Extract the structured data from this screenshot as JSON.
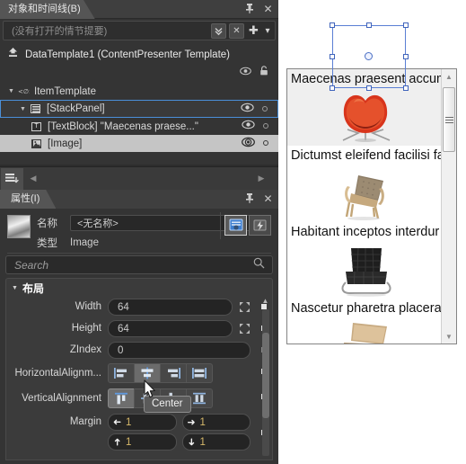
{
  "objects_panel": {
    "tab_label": "对象和时间线(B)",
    "pin_icon": "pin-icon",
    "close_icon": "close-icon",
    "storyboard_placeholder": "(没有打开的情节提要)",
    "storyboard_chevron_icon": "chevrons-down-icon",
    "storyboard_close_icon": "close-icon",
    "storyboard_add_icon": "plus-icon",
    "storyboard_more_icon": "dropdown-arrow-icon",
    "template_icon": "return-scope-icon",
    "template_label": "DataTemplate1 (ContentPresenter Template)",
    "eye_icon": "eye-icon",
    "lock_icon": "lock-icon",
    "tree": [
      {
        "label": "ItemTemplate",
        "icon": "template-icon",
        "depth": 0,
        "expander": "▼",
        "state": "normal",
        "has_eye": false,
        "has_dot": false
      },
      {
        "label": "[StackPanel]",
        "icon": "stackpanel-icon",
        "depth": 1,
        "expander": "▼",
        "state": "selected",
        "has_eye": true,
        "has_dot": true
      },
      {
        "label": "[TextBlock] \"Maecenas praese...\"",
        "icon": "textblock-icon",
        "depth": 2,
        "expander": "",
        "state": "normal",
        "has_eye": true,
        "has_dot": true
      },
      {
        "label": "[Image]",
        "icon": "image-icon",
        "depth": 2,
        "expander": "",
        "state": "highlight",
        "has_eye": true,
        "has_dot": true
      }
    ]
  },
  "strip_bar": {
    "layers_button_icon": "layers-down-icon",
    "left_arrow_icon": "left-arrow-icon",
    "right_arrow_icon": "right-arrow-icon"
  },
  "properties_panel": {
    "tab_label": "属性(I)",
    "pin_icon": "pin-icon",
    "close_icon": "close-icon",
    "thumbnail_icon": "image-thumbnail",
    "name_label": "名称",
    "name_value": "<无名称>",
    "type_label": "类型",
    "type_value": "Image",
    "properties_button_icon": "properties-view-icon",
    "events_button_icon": "events-view-icon",
    "search_placeholder": "Search",
    "search_icon": "magnifier-icon",
    "section_title": "布局",
    "section_caret_icon": "caret-down-icon",
    "rows": [
      {
        "label": "Width",
        "value": "64",
        "adv_icon": "auto-size-icon",
        "marker": "solid"
      },
      {
        "label": "Height",
        "value": "64",
        "adv_icon": "auto-size-icon",
        "marker": "solid"
      },
      {
        "label": "ZIndex",
        "value": "0",
        "adv_icon": "",
        "marker": "hollow"
      }
    ],
    "horizontal_alignment": {
      "label": "HorizontalAlignm...",
      "options": [
        "Left",
        "Center",
        "Right",
        "Stretch"
      ],
      "selected_index": 1,
      "marker": "solid"
    },
    "vertical_alignment": {
      "label": "VerticalAlignment",
      "options": [
        "Top",
        "Center",
        "Bottom",
        "Stretch"
      ],
      "selected_index": 0,
      "marker": "solid"
    },
    "margin": {
      "label": "Margin",
      "left": "1",
      "right": "1",
      "top": "1",
      "bottom": "1",
      "left_icon": "arrow-left-icon",
      "right_icon": "arrow-right-icon",
      "top_icon": "arrow-up-icon",
      "bottom_icon": "arrow-down-icon",
      "marker": "solid"
    },
    "scroll_up_icon": "scroll-up-arrow-icon"
  },
  "tooltip": {
    "text": "Center"
  },
  "cursor": {
    "icon": "mouse-pointer-icon"
  },
  "design_surface": {
    "list_items": [
      {
        "text": "Maecenas praesent accum",
        "image": "red-swan-chair",
        "selected": true
      },
      {
        "text": "Dictumst eleifend facilisi fa",
        "image": "wood-lounge-chair",
        "selected": false
      },
      {
        "text": "Habitant inceptos interdur",
        "image": "black-barcelona-chair",
        "selected": false
      },
      {
        "text": "Nascetur pharetra placera",
        "image": "tan-wood-chair",
        "selected": false
      }
    ],
    "scrollbar": {
      "up_icon": "scroll-up-arrow-icon",
      "down_icon": "scroll-down-arrow-icon",
      "grip_icon": "scrollbar-grip-icon"
    }
  },
  "colors": {
    "panel_bg": "#343434",
    "selection_blue": "#4a8fd4",
    "highlight_row": "#c5c5c5",
    "margin_value": "#d7b96a"
  }
}
